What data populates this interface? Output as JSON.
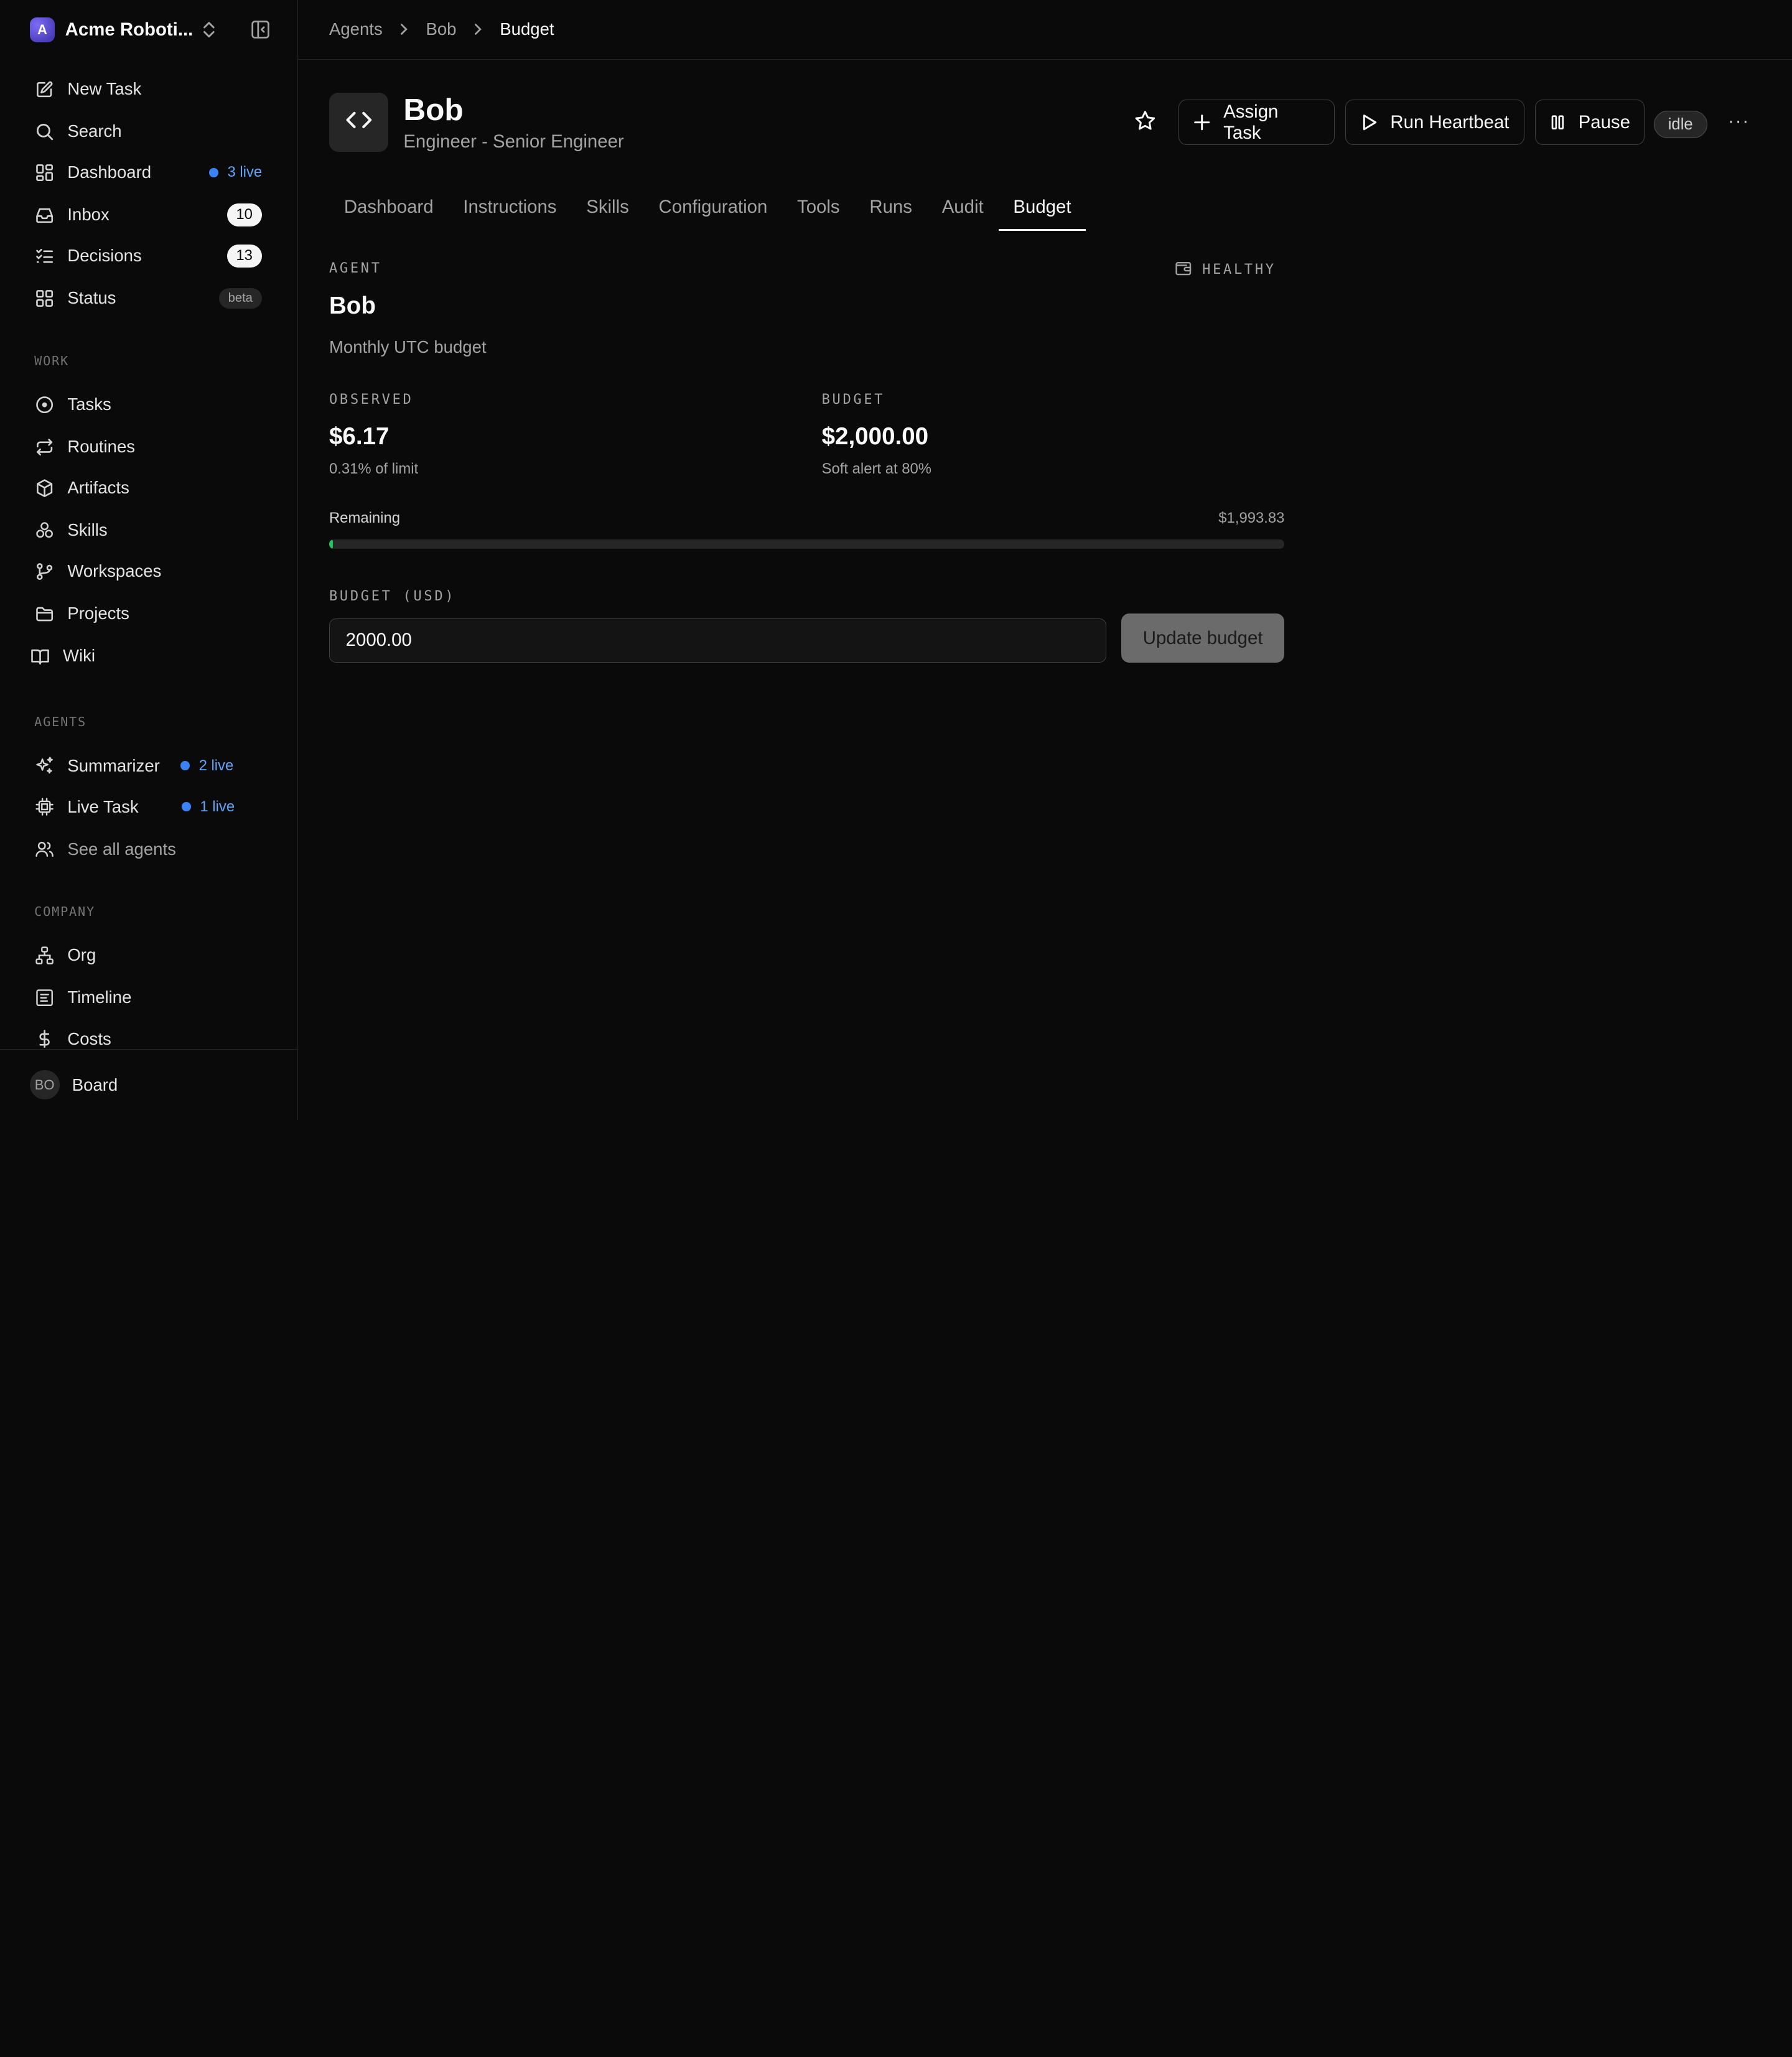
{
  "workspace": {
    "initial": "A",
    "name": "Acme Roboti..."
  },
  "nav": {
    "new_task": "New Task",
    "search": "Search",
    "dashboard": "Dashboard",
    "dashboard_live": "3 live",
    "inbox": "Inbox",
    "inbox_count": "10",
    "decisions": "Decisions",
    "decisions_count": "13",
    "status": "Status",
    "status_badge": "beta"
  },
  "work": {
    "heading": "WORK",
    "items": [
      "Tasks",
      "Routines",
      "Artifacts",
      "Skills",
      "Workspaces",
      "Projects",
      "Wiki"
    ]
  },
  "agents": {
    "heading": "AGENTS",
    "summarizer": "Summarizer",
    "summarizer_live": "2 live",
    "live_task": "Live Task",
    "live_task_live": "1 live",
    "see_all": "See all agents"
  },
  "company": {
    "heading": "COMPANY",
    "items": [
      "Org",
      "Timeline",
      "Costs"
    ]
  },
  "footer": {
    "avatar": "BO",
    "label": "Board"
  },
  "breadcrumb": [
    "Agents",
    "Bob",
    "Budget"
  ],
  "agent": {
    "name": "Bob",
    "role": "Engineer - Senior Engineer",
    "status": "idle"
  },
  "actions": {
    "assign": "Assign Task",
    "heartbeat": "Run Heartbeat",
    "pause": "Pause",
    "more": "···"
  },
  "tabs": [
    "Dashboard",
    "Instructions",
    "Skills",
    "Configuration",
    "Tools",
    "Runs",
    "Audit",
    "Budget"
  ],
  "budget": {
    "scope_label": "AGENT",
    "health": "HEALTHY",
    "name": "Bob",
    "period": "Monthly UTC budget",
    "observed_label": "OBSERVED",
    "observed_value": "$6.17",
    "observed_note": "0.31% of limit",
    "budget_label": "BUDGET",
    "budget_value": "$2,000.00",
    "budget_note": "Soft alert at 80%",
    "remaining_label": "Remaining",
    "remaining_value": "$1,993.83",
    "used_fraction": 0.0031,
    "input_label": "BUDGET (USD)",
    "input_value": "2000.00",
    "update_label": "Update budget"
  },
  "colors": {
    "accent_live": "#3b82f6",
    "progress": "#22c55e",
    "background": "#0a0a0a"
  }
}
